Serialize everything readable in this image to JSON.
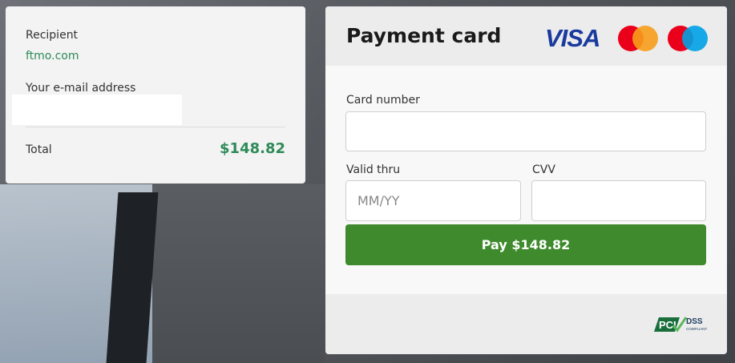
{
  "summary": {
    "recipient_label": "Recipient",
    "recipient_value": "ftmo.com",
    "email_label": "Your e-mail address",
    "total_label": "Total",
    "total_value": "$148.82"
  },
  "payment": {
    "title": "Payment card",
    "brands": [
      "VISA",
      "mastercard-icon",
      "maestro-icon"
    ],
    "card_number_label": "Card number",
    "card_number_value": "",
    "valid_thru_label": "Valid thru",
    "valid_thru_placeholder": "MM/YY",
    "cvv_label": "CVV",
    "cvv_value": "",
    "pay_label": "Pay $148.82",
    "pci_text": "DSS",
    "pci_logo_text": "PCI",
    "pci_sub": "COMPLIANT"
  },
  "colors": {
    "accent_green": "#3e8a2c",
    "total_green": "#2e8b57",
    "visa_blue": "#1a3a9e",
    "mc_red": "#eb001b",
    "mc_orange": "#f79e1b",
    "maestro_blue": "#00a2e5"
  }
}
